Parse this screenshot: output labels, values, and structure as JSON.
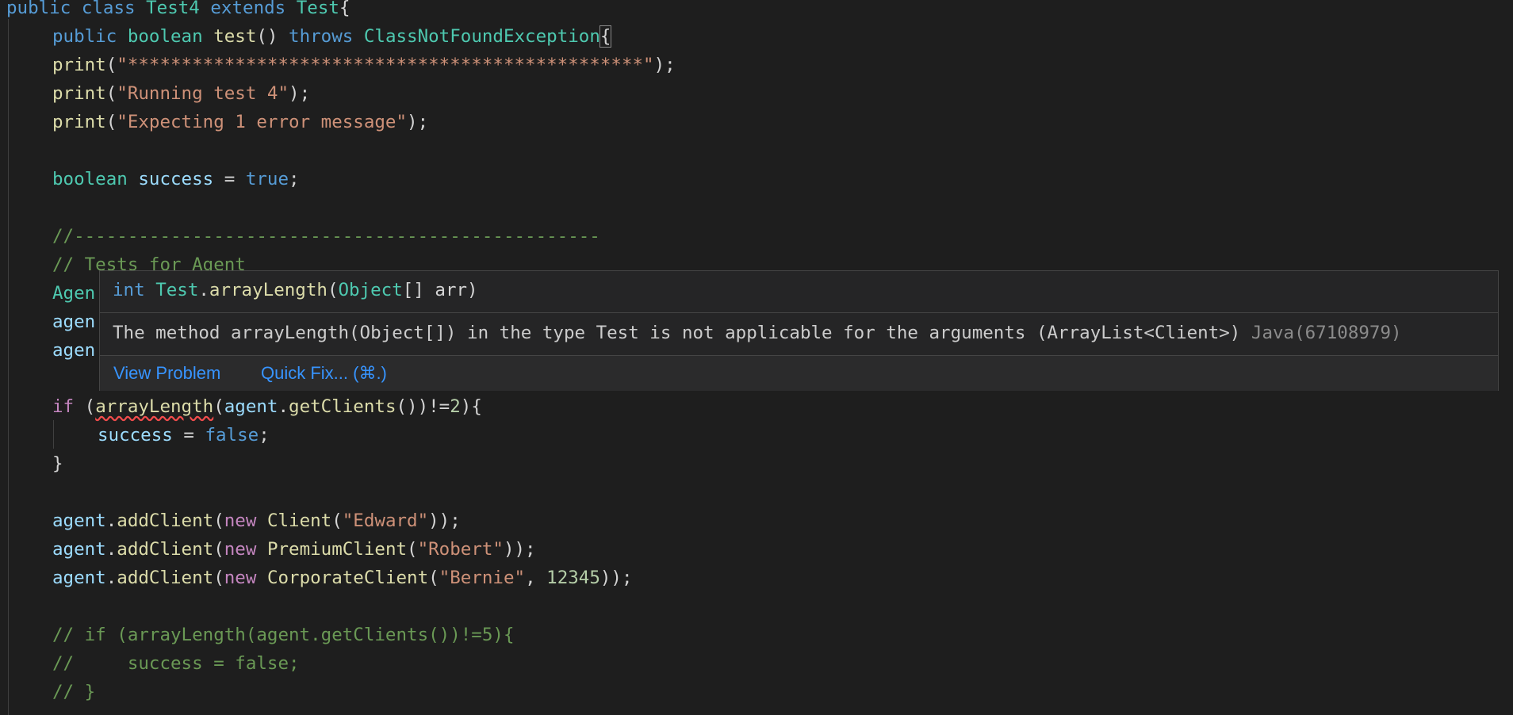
{
  "code": {
    "l1": {
      "t1": "public",
      "t2": "class",
      "t3": "Test4",
      "t4": "extends",
      "t5": "Test",
      "t6": "{"
    },
    "l2": {
      "t1": "public",
      "t2": "boolean",
      "t3": "test",
      "t4": "()",
      "t5": "throws",
      "t6": "ClassNotFoundException",
      "t7": "{"
    },
    "l3": {
      "t1": "print",
      "t2": "(",
      "t3": "\"************************************************\"",
      "t4": ");"
    },
    "l4": {
      "t1": "print",
      "t2": "(",
      "t3": "\"Running test 4\"",
      "t4": ");"
    },
    "l5": {
      "t1": "print",
      "t2": "(",
      "t3": "\"Expecting 1 error message\"",
      "t4": ");"
    },
    "l7": {
      "t1": "boolean",
      "t2": "success",
      "t3": " = ",
      "t4": "true",
      "t5": ";"
    },
    "l9": {
      "t1": "//-------------------------------------------------"
    },
    "l10": {
      "t1": "// Tests for Agent"
    },
    "l11": {
      "t1": "Agen"
    },
    "l12": {
      "t1": "agen"
    },
    "l13": {
      "t1": "agen"
    },
    "l14": {
      "t1": "if",
      "t2": " (",
      "t3": "arrayLength",
      "t4": "(",
      "t5": "agent",
      "t6": ".",
      "t7": "getClients",
      "t8": "())!=",
      "t9": "2",
      "t10": "){"
    },
    "l15": {
      "t1": "success",
      "t2": " = ",
      "t3": "false",
      "t4": ";"
    },
    "l16": {
      "t1": "}"
    },
    "l18": {
      "t1": "agent",
      "t2": ".",
      "t3": "addClient",
      "t4": "(",
      "t5": "new",
      "t6": " ",
      "t7": "Client",
      "t8": "(",
      "t9": "\"Edward\"",
      "t10": "));"
    },
    "l19": {
      "t1": "agent",
      "t2": ".",
      "t3": "addClient",
      "t4": "(",
      "t5": "new",
      "t6": " ",
      "t7": "PremiumClient",
      "t8": "(",
      "t9": "\"Robert\"",
      "t10": "));"
    },
    "l20": {
      "t1": "agent",
      "t2": ".",
      "t3": "addClient",
      "t4": "(",
      "t5": "new",
      "t6": " ",
      "t7": "CorporateClient",
      "t8": "(",
      "t9": "\"Bernie\"",
      "t10": ", ",
      "t11": "12345",
      "t12": "));"
    },
    "l22": {
      "t1": "// if (arrayLength(agent.getClients())!=5){"
    },
    "l23": {
      "t1": "//     success = false;"
    },
    "l24": {
      "t1": "// }"
    }
  },
  "hover": {
    "signature": {
      "s1": "int",
      "s2": " ",
      "s3": "Test",
      "s4": ".",
      "s5": "arrayLength",
      "s6": "(",
      "s7": "Object",
      "s8": "[] arr)"
    },
    "message": "The method arrayLength(Object[]) in the type Test is not applicable for the arguments (ArrayList<Client>)",
    "error_code": "Java(67108979)",
    "actions": {
      "view_problem": "View Problem",
      "quick_fix": "Quick Fix... (⌘.)"
    }
  },
  "colors": {
    "background": "#1e1e1e",
    "keyword": "#569cd6",
    "control_keyword": "#c586c0",
    "type": "#4ec9b0",
    "function": "#dcdcaa",
    "variable": "#9cdcfe",
    "string": "#ce9178",
    "number": "#b5cea8",
    "comment": "#6a9955",
    "link": "#3794ff"
  }
}
